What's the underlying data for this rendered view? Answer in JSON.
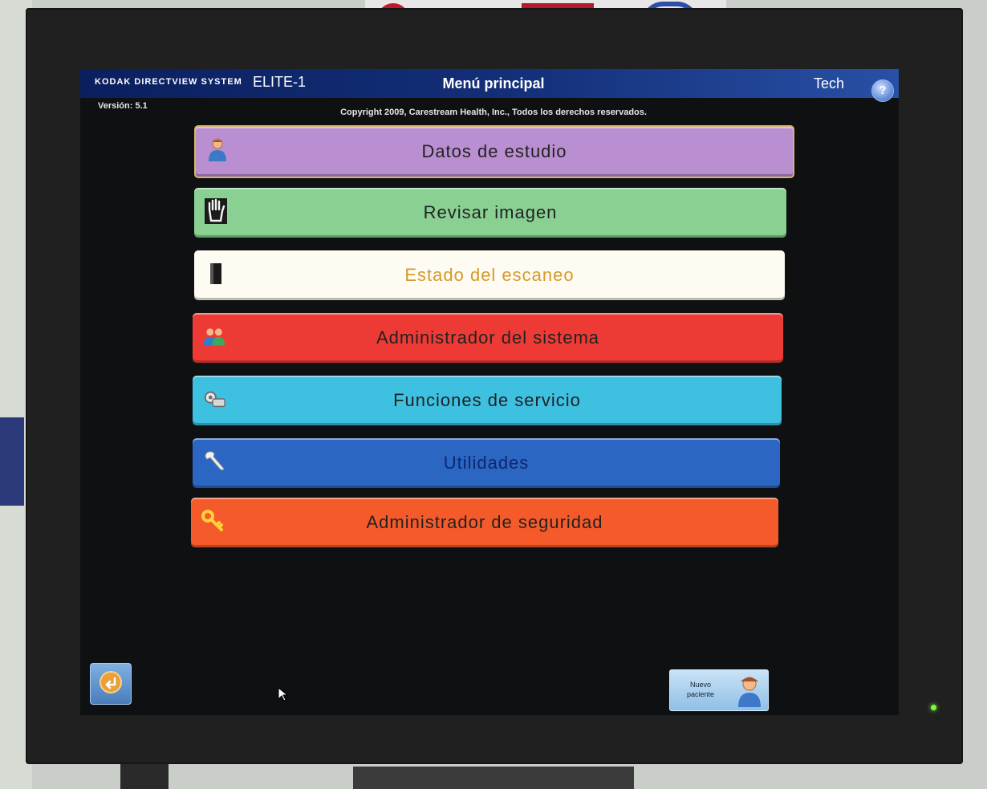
{
  "header": {
    "brand": "KODAK DIRECTVIEW SYSTEM",
    "model": "ELITE-1",
    "title": "Menú principal",
    "user": "Tech",
    "help_icon": "help-icon",
    "version": "Versión: 5.1",
    "copyright": "Copyright 2009, Carestream Health, Inc., Todos los derechos reservados."
  },
  "menu": {
    "items": [
      {
        "label": "Datos de estudio",
        "icon": "person-icon",
        "color": "#b98fd2"
      },
      {
        "label": "Revisar imagen",
        "icon": "hand-icon",
        "color": "#89d092"
      },
      {
        "label": "Estado del escaneo",
        "icon": "scanner-icon",
        "color": "#fdfbf2"
      },
      {
        "label": "Administrador del sistema",
        "icon": "users-icon",
        "color": "#ee3a34"
      },
      {
        "label": "Funciones de servicio",
        "icon": "service-icon",
        "color": "#3ec0e0"
      },
      {
        "label": "Utilidades",
        "icon": "wrench-icon",
        "color": "#2a66c2"
      },
      {
        "label": "Administrador de seguridad",
        "icon": "key-icon",
        "color": "#f55a2a"
      }
    ]
  },
  "footer": {
    "back_icon": "back-icon",
    "new_patient_label": "Nuevo paciente",
    "new_patient_icon": "patient-icon"
  }
}
